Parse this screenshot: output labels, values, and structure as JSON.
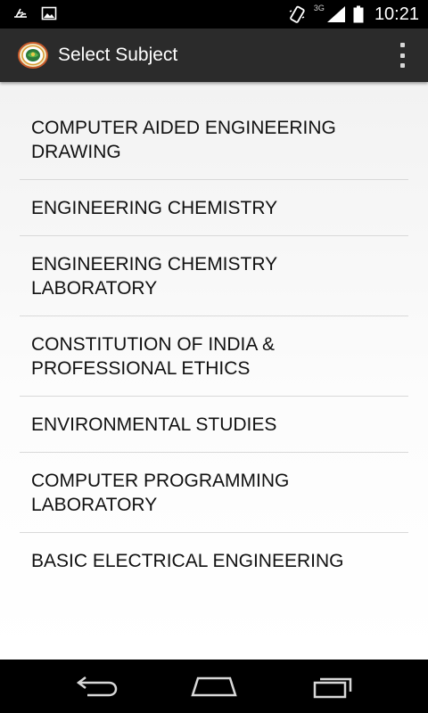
{
  "status_bar": {
    "time": "10:21",
    "network_label": "3G",
    "icons": [
      "notification-icon",
      "image-icon",
      "vibrate-icon",
      "signal-icon",
      "battery-icon"
    ]
  },
  "action_bar": {
    "title": "Select Subject",
    "logo_icon": "app-logo-icon",
    "menu_icon": "overflow-menu-icon",
    "background_color": "#2b2b2b"
  },
  "subjects": [
    {
      "label": "COMPUTER AIDED ENGINEERING DRAWING"
    },
    {
      "label": "ENGINEERING CHEMISTRY"
    },
    {
      "label": "ENGINEERING CHEMISTRY LABORATORY"
    },
    {
      "label": "CONSTITUTION OF INDIA & PROFESSIONAL ETHICS"
    },
    {
      "label": "ENVIRONMENTAL STUDIES"
    },
    {
      "label": "COMPUTER PROGRAMMING LABORATORY"
    },
    {
      "label": "BASIC ELECTRICAL ENGINEERING"
    }
  ],
  "nav_bar": {
    "icons": [
      "back-icon",
      "home-icon",
      "recent-apps-icon"
    ]
  }
}
